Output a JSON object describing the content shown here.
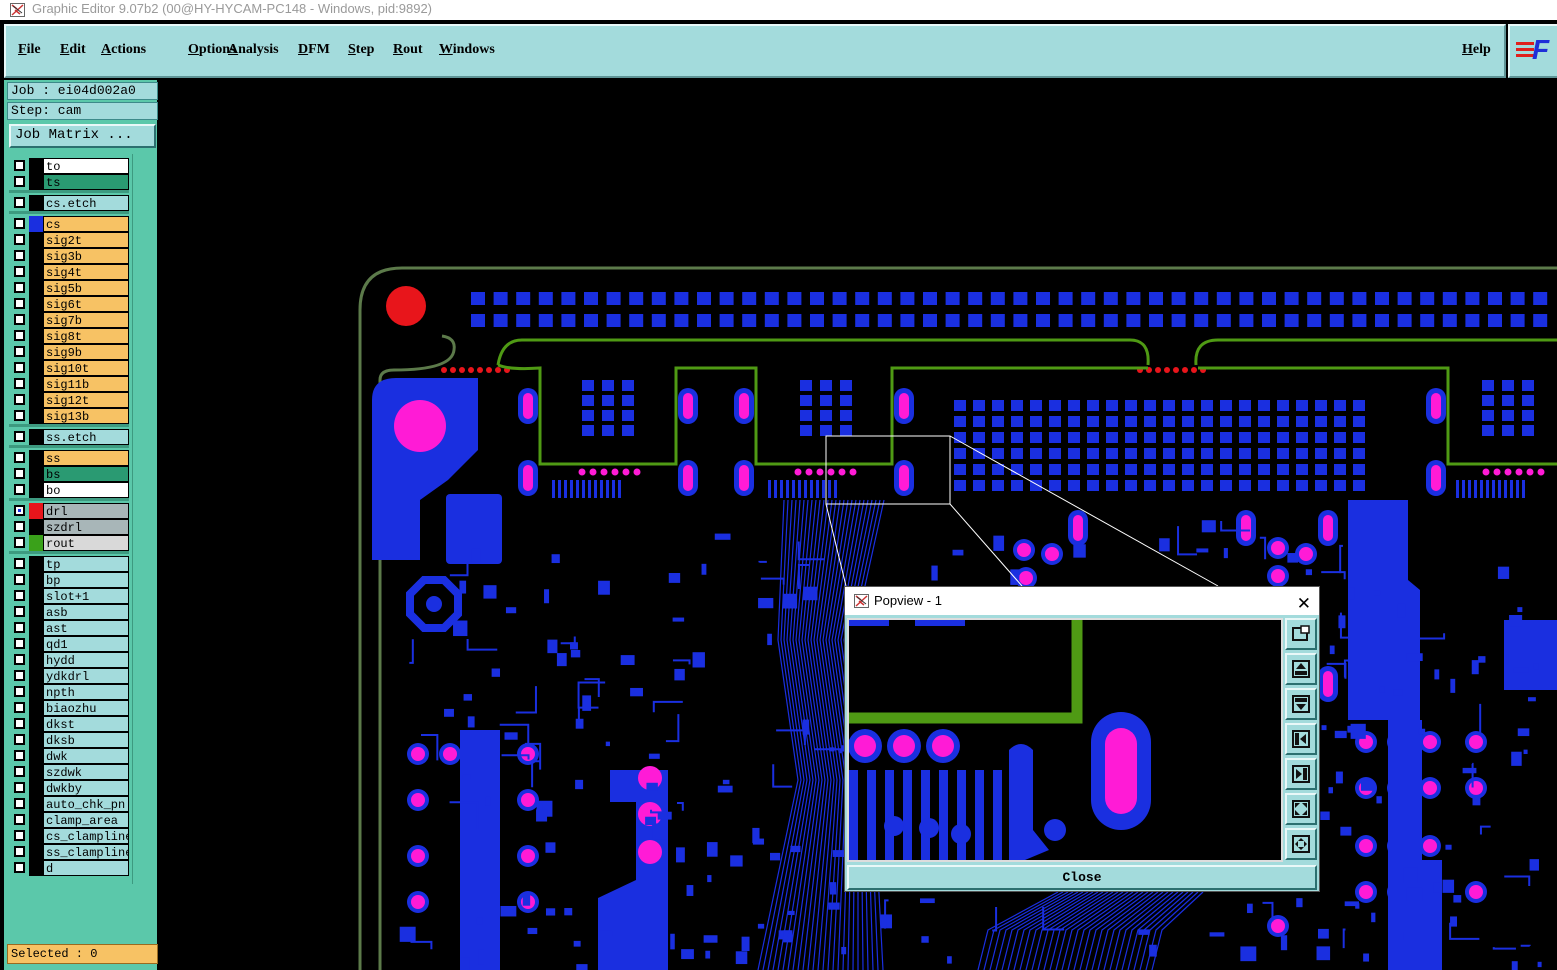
{
  "window": {
    "title": "Graphic Editor 9.07b2 (00@HY-HYCAM-PC148 - Windows, pid:9892)"
  },
  "menubar": {
    "items": [
      "File",
      "Edit",
      "Actions",
      "Options",
      "Analysis",
      "DFM",
      "Step",
      "Rout",
      "Windows"
    ],
    "help": "Help",
    "logo": "F"
  },
  "job": {
    "job_label": "Job : ei04d002a0",
    "step_label": "Step: cam",
    "matrix_button": "Job Matrix ..."
  },
  "layers": [
    {
      "name": "to",
      "swatch": "#000000",
      "style": "white"
    },
    {
      "name": "ts",
      "swatch": "#000000",
      "style": "selected"
    },
    {
      "name": "cs.etch",
      "swatch": "#000000",
      "style": "cyan",
      "sep_before": true
    },
    {
      "name": "cs",
      "swatch": "#1a2fe0",
      "style": "orange",
      "sep_before": true
    },
    {
      "name": "sig2t",
      "swatch": "#000000",
      "style": "orange"
    },
    {
      "name": "sig3b",
      "swatch": "#000000",
      "style": "orange"
    },
    {
      "name": "sig4t",
      "swatch": "#000000",
      "style": "orange"
    },
    {
      "name": "sig5b",
      "swatch": "#000000",
      "style": "orange"
    },
    {
      "name": "sig6t",
      "swatch": "#000000",
      "style": "orange"
    },
    {
      "name": "sig7b",
      "swatch": "#000000",
      "style": "orange"
    },
    {
      "name": "sig8t",
      "swatch": "#000000",
      "style": "orange"
    },
    {
      "name": "sig9b",
      "swatch": "#000000",
      "style": "orange"
    },
    {
      "name": "sig10t",
      "swatch": "#000000",
      "style": "orange"
    },
    {
      "name": "sig11b",
      "swatch": "#000000",
      "style": "orange"
    },
    {
      "name": "sig12t",
      "swatch": "#000000",
      "style": "orange"
    },
    {
      "name": "sig13b",
      "swatch": "#000000",
      "style": "orange"
    },
    {
      "name": "ss.etch",
      "swatch": "#000000",
      "style": "cyan",
      "sep_before": true
    },
    {
      "name": "ss",
      "swatch": "#000000",
      "style": "orange",
      "sep_before": true
    },
    {
      "name": "bs",
      "swatch": "#000000",
      "style": "selected"
    },
    {
      "name": "bo",
      "swatch": "#000000",
      "style": "white"
    },
    {
      "name": "drl",
      "swatch": "#e8151b",
      "style": "grey",
      "sep_before": true,
      "checked": true
    },
    {
      "name": "szdrl",
      "swatch": "#000000",
      "style": "grey"
    },
    {
      "name": "rout",
      "swatch": "#3aa11a",
      "style": "light"
    },
    {
      "name": "tp",
      "swatch": "#000000",
      "style": "cyan",
      "sep_before": true
    },
    {
      "name": "bp",
      "swatch": "#000000",
      "style": "cyan"
    },
    {
      "name": "slot+1",
      "swatch": "#000000",
      "style": "cyan"
    },
    {
      "name": "asb",
      "swatch": "#000000",
      "style": "cyan"
    },
    {
      "name": "ast",
      "swatch": "#000000",
      "style": "cyan"
    },
    {
      "name": "qd1",
      "swatch": "#000000",
      "style": "cyan"
    },
    {
      "name": "hydd",
      "swatch": "#000000",
      "style": "cyan"
    },
    {
      "name": "ydkdrl",
      "swatch": "#000000",
      "style": "cyan"
    },
    {
      "name": "npth",
      "swatch": "#000000",
      "style": "cyan"
    },
    {
      "name": "biaozhu",
      "swatch": "#000000",
      "style": "cyan"
    },
    {
      "name": "dkst",
      "swatch": "#000000",
      "style": "cyan"
    },
    {
      "name": "dksb",
      "swatch": "#000000",
      "style": "cyan"
    },
    {
      "name": "dwk",
      "swatch": "#000000",
      "style": "cyan"
    },
    {
      "name": "szdwk",
      "swatch": "#000000",
      "style": "cyan"
    },
    {
      "name": "dwkby",
      "swatch": "#000000",
      "style": "cyan"
    },
    {
      "name": "auto_chk_pn",
      "swatch": "#000000",
      "style": "cyan"
    },
    {
      "name": "clamp_area",
      "swatch": "#000000",
      "style": "cyan"
    },
    {
      "name": "cs_clampline",
      "swatch": "#000000",
      "style": "cyan"
    },
    {
      "name": "ss_clampline",
      "swatch": "#000000",
      "style": "cyan"
    },
    {
      "name": "d",
      "swatch": "#000000",
      "style": "cyan"
    }
  ],
  "status": {
    "selected": "Selected : 0"
  },
  "popview": {
    "title": "Popview - 1",
    "close_button": "Close",
    "tools": [
      "fit-icon",
      "zoom-in-icon",
      "zoom-out-icon",
      "pan-left-icon",
      "pan-right-icon",
      "expand-icon",
      "shrink-icon"
    ]
  },
  "colors": {
    "menu_bg": "#a3dbdc",
    "panel_bg": "#5bc8aa",
    "copper": "#1a2fe0",
    "pad": "#ff1bd6",
    "rout": "#4f9a14",
    "drill": "#e8151b",
    "layer_orange": "#f7c264",
    "layer_selected": "#2a9a72"
  }
}
